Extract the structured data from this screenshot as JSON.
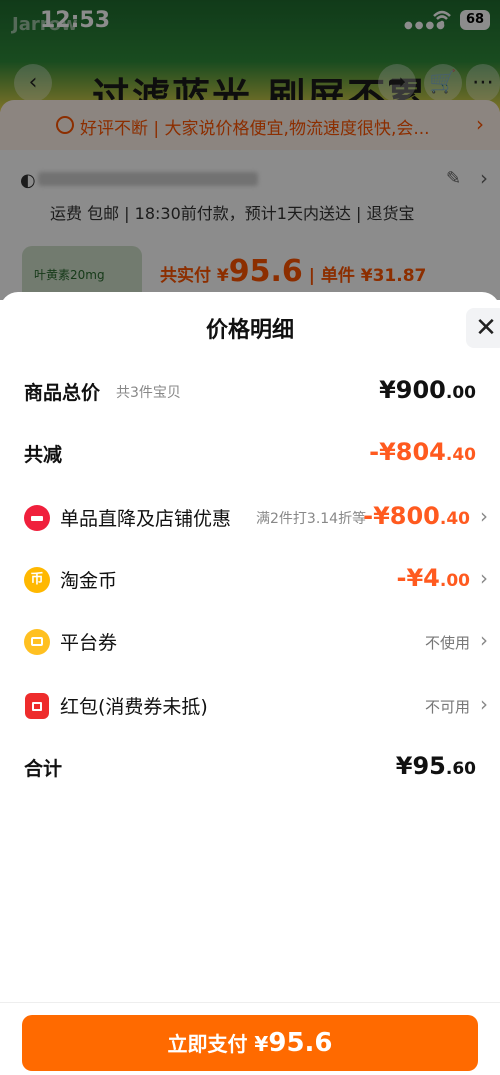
{
  "status_bar": {
    "time": "12:53",
    "battery": "68"
  },
  "background": {
    "brand": "Jarrow",
    "banner_slogan": "过滤蓝光 刷屏不累",
    "review_text": "好评不断 | 大家说价格便宜,物流速度很快,会...",
    "shipping_text": "运费 包邮 | 18:30前付款，预计1天内送达 | 退货宝",
    "product_thumb_text": "叶黄素20mg",
    "pay_label": "共实付 ¥",
    "pay_amount": "95.6",
    "unit_label": "| 单件 ¥31.87"
  },
  "sheet": {
    "title": "价格明细",
    "rows": [
      {
        "label": "商品总价",
        "sub": "共3件宝贝",
        "value_int": "¥900",
        "value_dec": ".00"
      },
      {
        "label": "共减",
        "value_int": "-¥804",
        "value_dec": ".40"
      },
      {
        "label": "单品直降及店铺优惠",
        "sub": "满2件打3.14折等",
        "value_int": "-¥800",
        "value_dec": ".40"
      },
      {
        "label": "淘金币",
        "icon_text": "币",
        "value_int": "-¥4",
        "value_dec": ".00"
      },
      {
        "label": "平台券",
        "value": "不使用"
      },
      {
        "label": "红包(消费券未抵)",
        "value": "不可用"
      },
      {
        "label": "合计",
        "value_int": "¥95",
        "value_dec": ".60"
      }
    ]
  },
  "pay_button": {
    "label": "立即支付 ¥",
    "amount": "95.6"
  },
  "colors": {
    "accent": "#ff6a00",
    "discount": "#ff5a1f",
    "review": "#ff5500"
  }
}
